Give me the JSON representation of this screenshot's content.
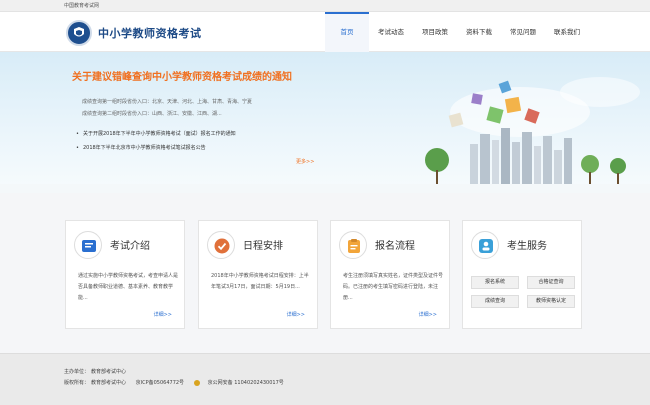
{
  "topbar": {
    "text": "中国教育考试网"
  },
  "header": {
    "site_title": "中小学教师资格考试"
  },
  "nav": [
    {
      "label": "首页",
      "active": true
    },
    {
      "label": "考试动态"
    },
    {
      "label": "项目政策"
    },
    {
      "label": "资料下载"
    },
    {
      "label": "常见问题"
    },
    {
      "label": "联系我们"
    }
  ],
  "banner": {
    "title": "关于建议错峰查询中小学教师资格考试成绩的通知",
    "line1": "成绩查询第一组时段省份入口：北京、天津、河北、上海、甘肃、青海、宁夏",
    "line2": "成绩查询第二组时段省份入口：山西、浙江、安徽、江西、湖...",
    "news": [
      "关于开展2018年下半年中小学教师资格考试（面试）报名工作的通知",
      "2018年下半年北京市中小学教师资格考试笔试报名公告"
    ],
    "more": "更多>>"
  },
  "cards": [
    {
      "title": "考试介绍",
      "desc": "通过实施中小学教师资格考试，考查申请人是否具备教师职业道德、基本素养、教育教学能...",
      "more": "详细>>"
    },
    {
      "title": "日程安排",
      "desc": "2018年中小学教师资格考试日程安排：上半年笔试3月17日，面试日期：5月19日...",
      "more": "详细>>"
    },
    {
      "title": "报名流程",
      "desc": "考生注册须填写真实姓名，证件类型及证件号码。已注册的考生填写密码进行登陆，未注册...",
      "more": "详细>>"
    },
    {
      "title": "考生服务",
      "buttons": [
        "报名系统",
        "合格证查询",
        "成绩查询",
        "教师资格认定"
      ]
    }
  ],
  "footer": {
    "sponsor_label": "主办单位：",
    "sponsor": "教育部考试中心",
    "copyright_label": "版权所有：",
    "copyright": "教育部考试中心",
    "icp": "京ICP备05064772号",
    "police": "京公网安备 11040202430017号"
  }
}
